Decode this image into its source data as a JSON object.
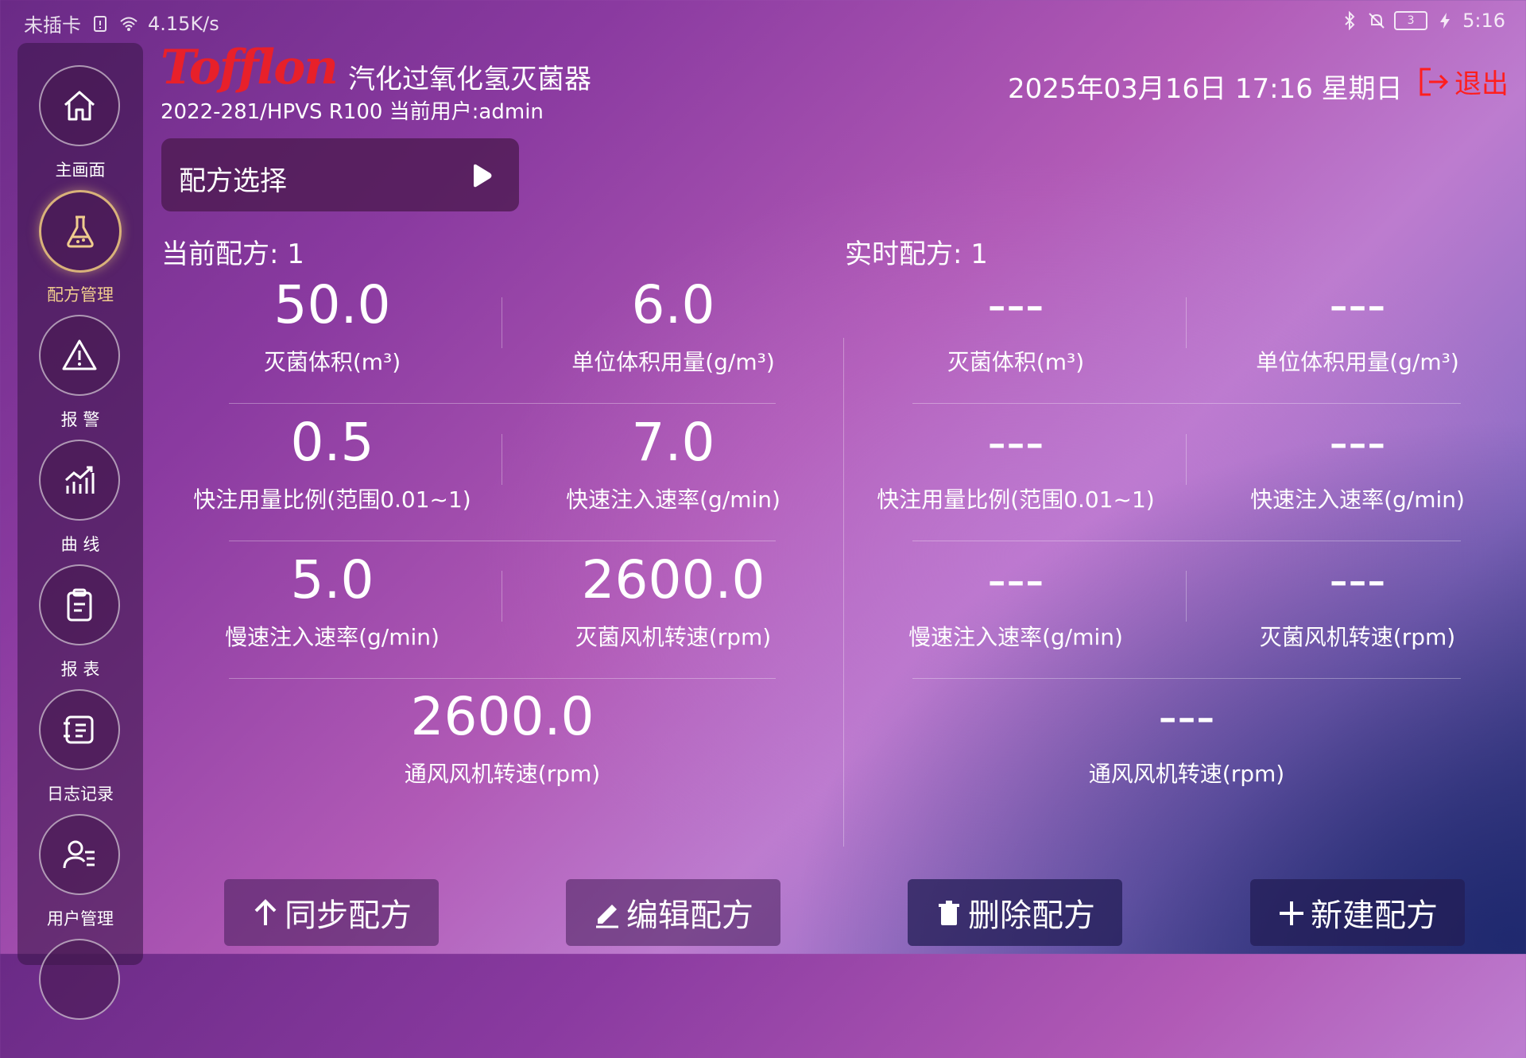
{
  "status_bar": {
    "carrier": "未插卡",
    "net_speed": "4.15K/s",
    "battery": "3",
    "time": "5:16"
  },
  "header": {
    "logo": "Tofflon",
    "title": "汽化过氧化氢灭菌器",
    "subtitle": "2022-281/HPVS R100 当前用户:admin",
    "datetime": "2025年03月16日 17:16 星期日",
    "logout": "退出"
  },
  "sidebar": {
    "items": [
      {
        "label": "主画面",
        "icon": "home-icon"
      },
      {
        "label": "配方管理",
        "icon": "flask-icon"
      },
      {
        "label": "报 警",
        "icon": "alarm-icon"
      },
      {
        "label": "曲 线",
        "icon": "chart-icon"
      },
      {
        "label": "报 表",
        "icon": "clipboard-icon"
      },
      {
        "label": "日志记录",
        "icon": "log-icon"
      },
      {
        "label": "用户管理",
        "icon": "user-icon"
      }
    ]
  },
  "recipe_select": {
    "label": "配方选择"
  },
  "current": {
    "title": "当前配方: 1",
    "params": [
      {
        "value": "50.0",
        "label": "灭菌体积(m³)"
      },
      {
        "value": "6.0",
        "label": "单位体积用量(g/m³)"
      },
      {
        "value": "0.5",
        "label": "快注用量比例(范围0.01~1)"
      },
      {
        "value": "7.0",
        "label": "快速注入速率(g/min)"
      },
      {
        "value": "5.0",
        "label": "慢速注入速率(g/min)"
      },
      {
        "value": "2600.0",
        "label": "灭菌风机转速(rpm)"
      },
      {
        "value": "2600.0",
        "label": "通风风机转速(rpm)"
      }
    ]
  },
  "realtime": {
    "title": "实时配方: 1",
    "params": [
      {
        "value": "---",
        "label": "灭菌体积(m³)"
      },
      {
        "value": "---",
        "label": "单位体积用量(g/m³)"
      },
      {
        "value": "---",
        "label": "快注用量比例(范围0.01~1)"
      },
      {
        "value": "---",
        "label": "快速注入速率(g/min)"
      },
      {
        "value": "---",
        "label": "慢速注入速率(g/min)"
      },
      {
        "value": "---",
        "label": "灭菌风机转速(rpm)"
      },
      {
        "value": "---",
        "label": "通风风机转速(rpm)"
      }
    ]
  },
  "buttons": {
    "sync": "同步配方",
    "edit": "编辑配方",
    "delete": "删除配方",
    "new": "新建配方"
  },
  "colors": {
    "accent_red": "#e8202a",
    "active_gold": "#d9b27a"
  }
}
